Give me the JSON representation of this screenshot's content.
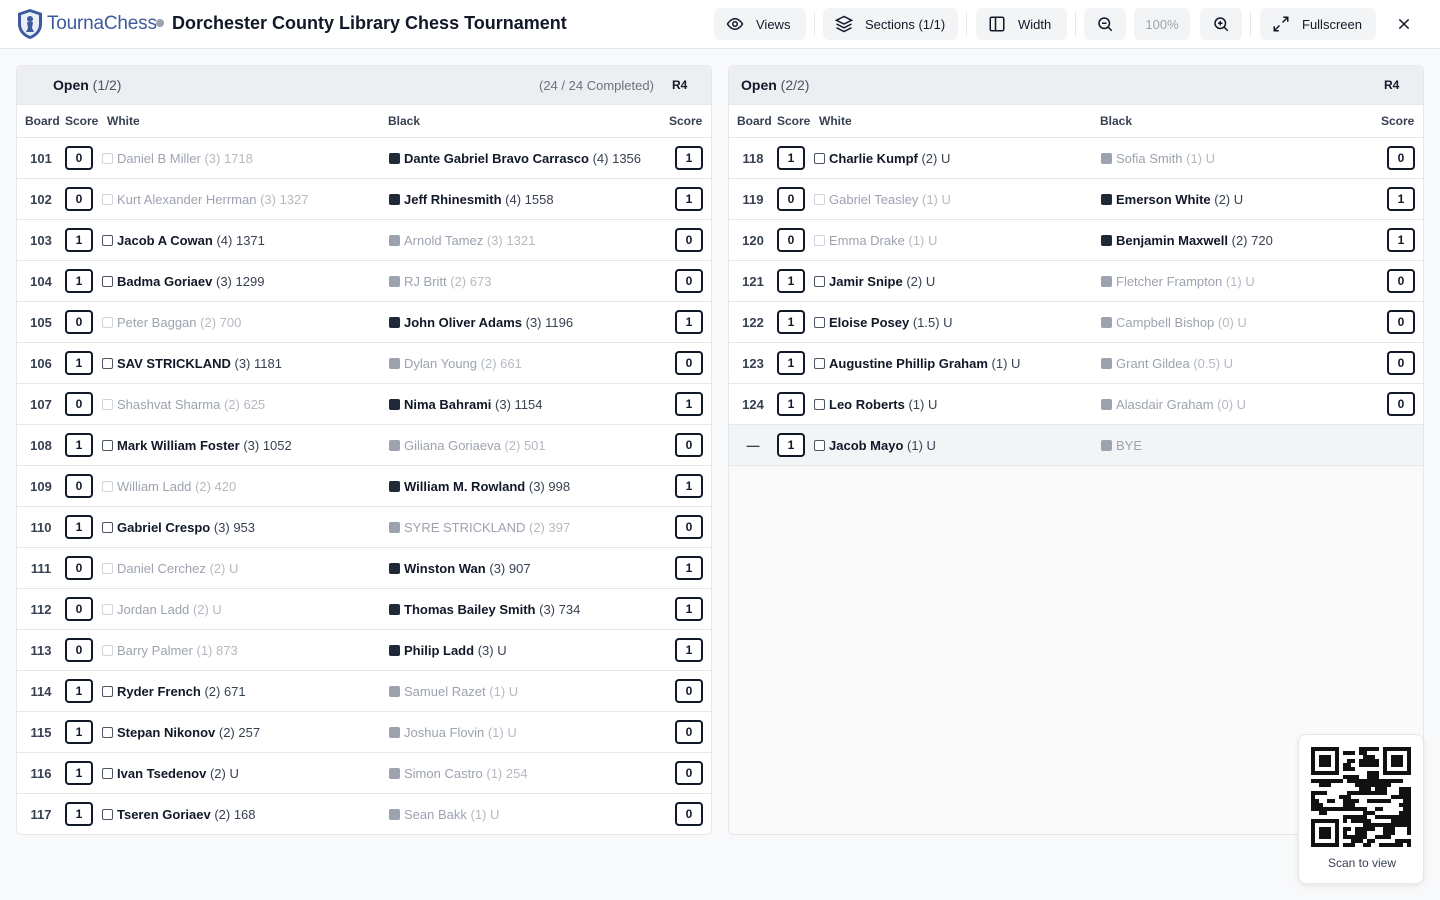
{
  "app": {
    "brand_part1": "Tourna",
    "brand_part2": "Chess",
    "title": "Dorchester County Library Chess Tournament"
  },
  "toolbar": {
    "views_label": "Views",
    "sections_label": "Sections (1/1)",
    "width_label": "Width",
    "zoom_value": "100%",
    "fullscreen_label": "Fullscreen"
  },
  "columns": {
    "board": "Board",
    "score": "Score",
    "white": "White",
    "black": "Black"
  },
  "sections": [
    {
      "title": "Open",
      "part": "(1/2)",
      "completed": "(24 / 24 Completed)",
      "round": "R4",
      "pairings": [
        {
          "board": "101",
          "white_score": "0",
          "white_name": "Daniel B Miller",
          "white_meta": "(3) 1718",
          "black_name": "Dante Gabriel Bravo Carrasco",
          "black_meta": "(4) 1356",
          "black_score": "1"
        },
        {
          "board": "102",
          "white_score": "0",
          "white_name": "Kurt Alexander Herrman",
          "white_meta": "(3) 1327",
          "black_name": "Jeff Rhinesmith",
          "black_meta": "(4) 1558",
          "black_score": "1"
        },
        {
          "board": "103",
          "white_score": "1",
          "white_name": "Jacob A Cowan",
          "white_meta": "(4) 1371",
          "black_name": "Arnold Tamez",
          "black_meta": "(3) 1321",
          "black_score": "0"
        },
        {
          "board": "104",
          "white_score": "1",
          "white_name": "Badma Goriaev",
          "white_meta": "(3) 1299",
          "black_name": "RJ Britt",
          "black_meta": "(2) 673",
          "black_score": "0"
        },
        {
          "board": "105",
          "white_score": "0",
          "white_name": "Peter Baggan",
          "white_meta": "(2) 700",
          "black_name": "John Oliver Adams",
          "black_meta": "(3) 1196",
          "black_score": "1"
        },
        {
          "board": "106",
          "white_score": "1",
          "white_name": "SAV STRICKLAND",
          "white_meta": "(3) 1181",
          "black_name": "Dylan Young",
          "black_meta": "(2) 661",
          "black_score": "0"
        },
        {
          "board": "107",
          "white_score": "0",
          "white_name": "Shashvat Sharma",
          "white_meta": "(2) 625",
          "black_name": "Nima Bahrami",
          "black_meta": "(3) 1154",
          "black_score": "1"
        },
        {
          "board": "108",
          "white_score": "1",
          "white_name": "Mark William Foster",
          "white_meta": "(3) 1052",
          "black_name": "Giliana Goriaeva",
          "black_meta": "(2) 501",
          "black_score": "0"
        },
        {
          "board": "109",
          "white_score": "0",
          "white_name": "William Ladd",
          "white_meta": "(2) 420",
          "black_name": "William M. Rowland",
          "black_meta": "(3) 998",
          "black_score": "1"
        },
        {
          "board": "110",
          "white_score": "1",
          "white_name": "Gabriel Crespo",
          "white_meta": "(3) 953",
          "black_name": "SYRE STRICKLAND",
          "black_meta": "(2) 397",
          "black_score": "0"
        },
        {
          "board": "111",
          "white_score": "0",
          "white_name": "Daniel Cerchez",
          "white_meta": "(2) U",
          "black_name": "Winston Wan",
          "black_meta": "(3) 907",
          "black_score": "1"
        },
        {
          "board": "112",
          "white_score": "0",
          "white_name": "Jordan Ladd",
          "white_meta": "(2) U",
          "black_name": "Thomas Bailey Smith",
          "black_meta": "(3) 734",
          "black_score": "1"
        },
        {
          "board": "113",
          "white_score": "0",
          "white_name": "Barry Palmer",
          "white_meta": "(1) 873",
          "black_name": "Philip Ladd",
          "black_meta": "(3) U",
          "black_score": "1"
        },
        {
          "board": "114",
          "white_score": "1",
          "white_name": "Ryder French",
          "white_meta": "(2) 671",
          "black_name": "Samuel Razet",
          "black_meta": "(1) U",
          "black_score": "0"
        },
        {
          "board": "115",
          "white_score": "1",
          "white_name": "Stepan Nikonov",
          "white_meta": "(2) 257",
          "black_name": "Joshua Flovin",
          "black_meta": "(1) U",
          "black_score": "0"
        },
        {
          "board": "116",
          "white_score": "1",
          "white_name": "Ivan Tsedenov",
          "white_meta": "(2) U",
          "black_name": "Simon Castro",
          "black_meta": "(1) 254",
          "black_score": "0"
        },
        {
          "board": "117",
          "white_score": "1",
          "white_name": "Tseren Goriaev",
          "white_meta": "(2) 168",
          "black_name": "Sean Bakk",
          "black_meta": "(1) U",
          "black_score": "0"
        }
      ]
    },
    {
      "title": "Open",
      "part": "(2/2)",
      "completed": "",
      "round": "R4",
      "pairings": [
        {
          "board": "118",
          "white_score": "1",
          "white_name": "Charlie Kumpf",
          "white_meta": "(2) U",
          "black_name": "Sofia Smith",
          "black_meta": "(1) U",
          "black_score": "0"
        },
        {
          "board": "119",
          "white_score": "0",
          "white_name": "Gabriel Teasley",
          "white_meta": "(1) U",
          "black_name": "Emerson White",
          "black_meta": "(2) U",
          "black_score": "1"
        },
        {
          "board": "120",
          "white_score": "0",
          "white_name": "Emma Drake",
          "white_meta": "(1) U",
          "black_name": "Benjamin Maxwell",
          "black_meta": "(2) 720",
          "black_score": "1"
        },
        {
          "board": "121",
          "white_score": "1",
          "white_name": "Jamir Snipe",
          "white_meta": "(2) U",
          "black_name": "Fletcher Frampton",
          "black_meta": "(1) U",
          "black_score": "0"
        },
        {
          "board": "122",
          "white_score": "1",
          "white_name": "Eloise Posey",
          "white_meta": "(1.5) U",
          "black_name": "Campbell Bishop",
          "black_meta": "(0) U",
          "black_score": "0"
        },
        {
          "board": "123",
          "white_score": "1",
          "white_name": "Augustine Phillip Graham",
          "white_meta": "(1) U",
          "black_name": "Grant Gildea",
          "black_meta": "(0.5) U",
          "black_score": "0"
        },
        {
          "board": "124",
          "white_score": "1",
          "white_name": "Leo Roberts",
          "white_meta": "(1) U",
          "black_name": "Alasdair Graham",
          "black_meta": "(0) U",
          "black_score": "0"
        },
        {
          "board": "—",
          "white_score": "1",
          "white_name": "Jacob Mayo",
          "white_meta": "(1) U",
          "black_name": "BYE",
          "black_meta": "",
          "black_score": ""
        }
      ]
    }
  ],
  "qr": {
    "label": "Scan to view"
  }
}
